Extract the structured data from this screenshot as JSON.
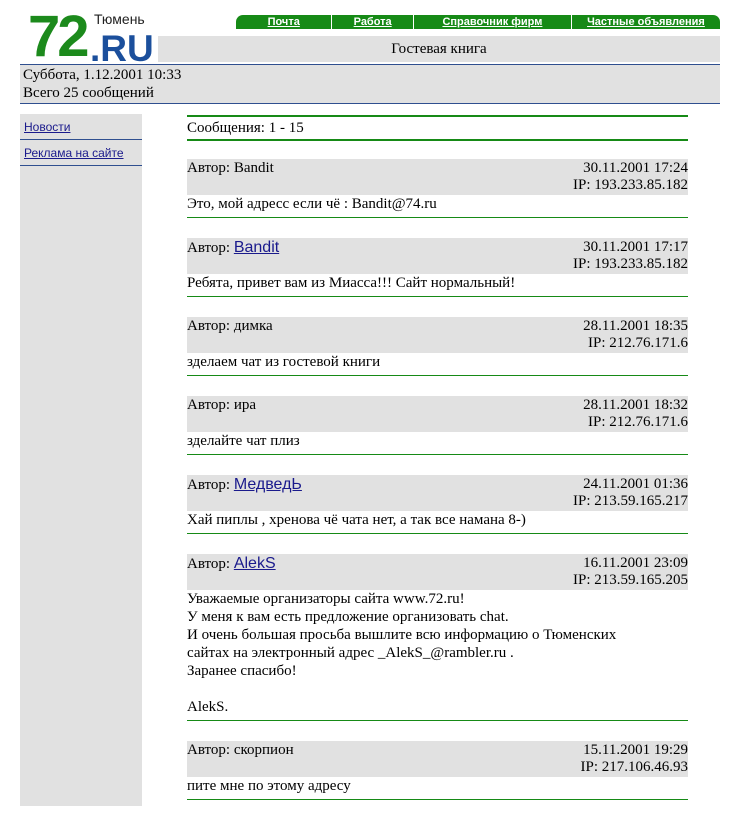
{
  "header": {
    "logo_number": "72",
    "logo_domain": ".RU",
    "logo_city": "Тюмень",
    "page_title": "Гостевая книга"
  },
  "topnav": [
    {
      "label": "Почта"
    },
    {
      "label": "Работа"
    },
    {
      "label": "Справочник фирм"
    },
    {
      "label": "Частные объявления"
    }
  ],
  "info": {
    "date": "Суббота, 1.12.2001 10:33",
    "total": "Всего 25 сообщений"
  },
  "sidebar": {
    "items": [
      {
        "label": "Новости"
      },
      {
        "label": "Реклама на сайте"
      }
    ]
  },
  "list": {
    "range_label": "Сообщения: 1 - 15"
  },
  "messages": [
    {
      "author_prefix": "Автор: ",
      "author": "Bandit",
      "author_link": false,
      "date": "30.11.2001 17:24",
      "ip": "IP: 193.233.85.182",
      "lines": [
        "Это, мой адресс если чё : Bandit@74.ru"
      ]
    },
    {
      "author_prefix": "Автор: ",
      "author": "Bandit",
      "author_link": true,
      "date": "30.11.2001 17:17",
      "ip": "IP: 193.233.85.182",
      "lines": [
        "Ребята, привет вам из Миасса!!! Сайт нормальный!"
      ]
    },
    {
      "author_prefix": "Автор: ",
      "author": "димка",
      "author_link": false,
      "date": "28.11.2001 18:35",
      "ip": "IP: 212.76.171.6",
      "lines": [
        "зделаем чат из гостевой книги"
      ]
    },
    {
      "author_prefix": "Автор: ",
      "author": "ира",
      "author_link": false,
      "date": "28.11.2001 18:32",
      "ip": "IP: 212.76.171.6",
      "lines": [
        "зделайте чат плиз"
      ]
    },
    {
      "author_prefix": "Автор: ",
      "author": "МедведЬ",
      "author_link": true,
      "date": "24.11.2001 01:36",
      "ip": "IP: 213.59.165.217",
      "lines": [
        "Хай пиплы , хренова чё чата нет, а так все намана 8-)"
      ]
    },
    {
      "author_prefix": "Автор: ",
      "author": "AlekS",
      "author_link": true,
      "date": "16.11.2001 23:09",
      "ip": "IP: 213.59.165.205",
      "lines": [
        "Уважаемые организаторы сайта www.72.ru!",
        "У меня к вам есть предложение организовать chat.",
        "И очень большая просьба вышлите всю информацию о Тюменских",
        "сайтах на электронный адрес _AlekS_@rambler.ru .",
        "Заранее спасибо!",
        "",
        "AlekS."
      ]
    },
    {
      "author_prefix": "Автор: ",
      "author": "скорпион",
      "author_link": false,
      "date": "15.11.2001 19:29",
      "ip": "IP: 217.106.46.93",
      "lines": [
        "пите мне по этому адресу"
      ]
    }
  ]
}
